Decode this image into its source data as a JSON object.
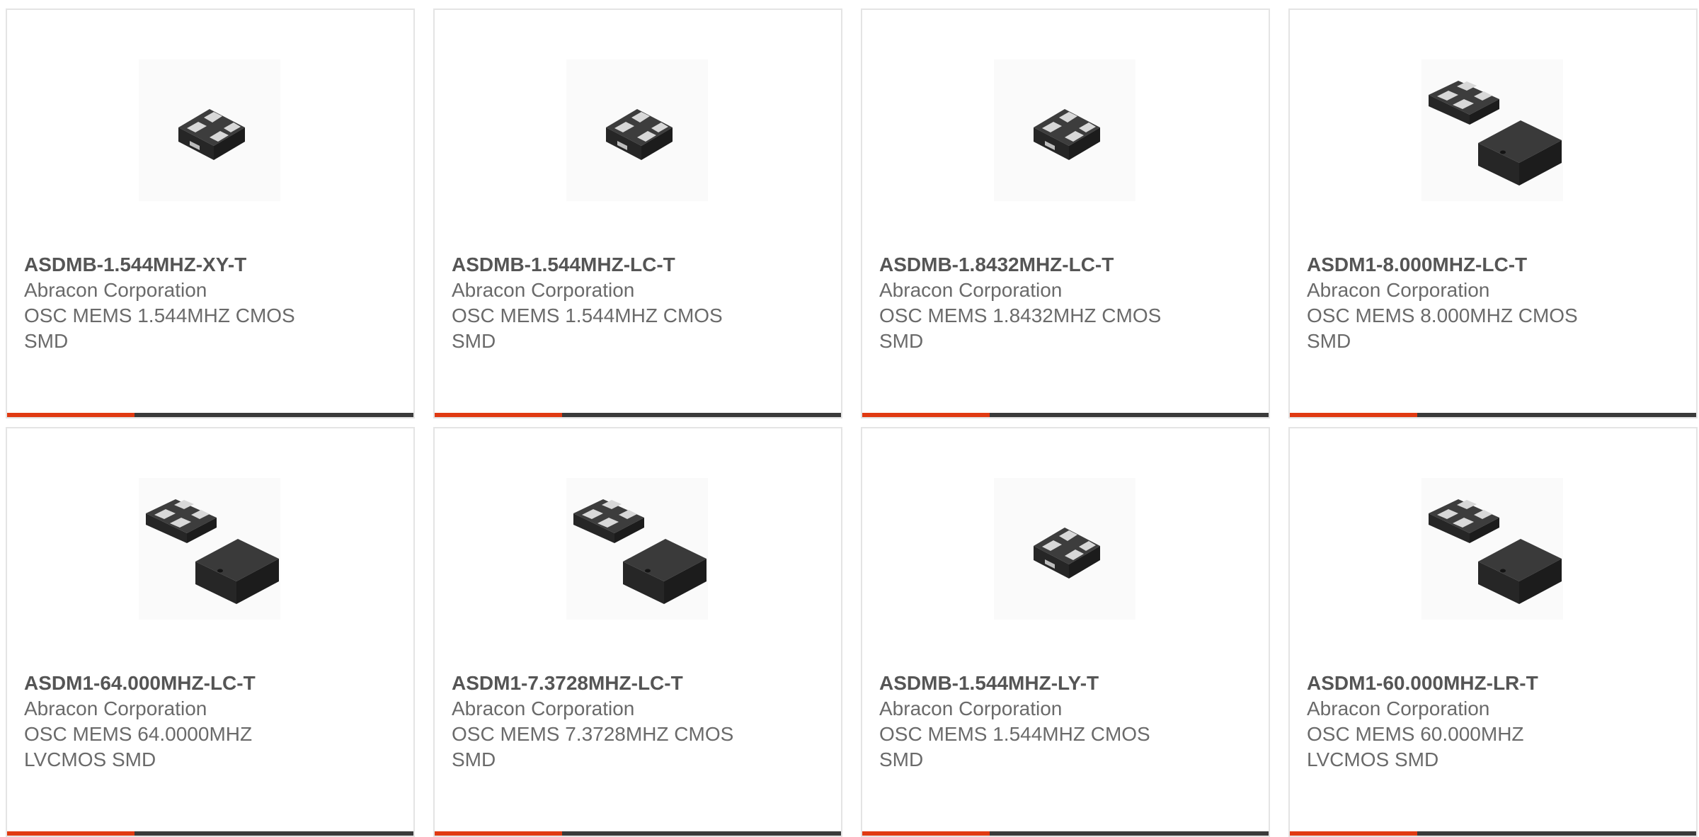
{
  "accent_color": "#e03a12",
  "bar_color": "#3a3a3a",
  "products": [
    {
      "part": "ASDMB-1.544MHZ-XY-T",
      "manufacturer": "Abracon Corporation",
      "description": "OSC MEMS 1.544MHZ CMOS SMD",
      "image": "single-package"
    },
    {
      "part": "ASDMB-1.544MHZ-LC-T",
      "manufacturer": "Abracon Corporation",
      "description": "OSC MEMS 1.544MHZ CMOS SMD",
      "image": "single-package"
    },
    {
      "part": "ASDMB-1.8432MHZ-LC-T",
      "manufacturer": "Abracon Corporation",
      "description": "OSC MEMS 1.8432MHZ CMOS SMD",
      "image": "single-package"
    },
    {
      "part": "ASDM1-8.000MHZ-LC-T",
      "manufacturer": "Abracon Corporation",
      "description": "OSC MEMS 8.000MHZ CMOS SMD",
      "image": "pair-package"
    },
    {
      "part": "ASDM1-64.000MHZ-LC-T",
      "manufacturer": "Abracon Corporation",
      "description": "OSC MEMS 64.0000MHZ LVCMOS SMD",
      "image": "pair-package"
    },
    {
      "part": "ASDM1-7.3728MHZ-LC-T",
      "manufacturer": "Abracon Corporation",
      "description": "OSC MEMS 7.3728MHZ CMOS SMD",
      "image": "pair-package"
    },
    {
      "part": "ASDMB-1.544MHZ-LY-T",
      "manufacturer": "Abracon Corporation",
      "description": "OSC MEMS 1.544MHZ CMOS SMD",
      "image": "single-package"
    },
    {
      "part": "ASDM1-60.000MHZ-LR-T",
      "manufacturer": "Abracon Corporation",
      "description": "OSC MEMS 60.000MHZ LVCMOS SMD",
      "image": "pair-package"
    }
  ]
}
